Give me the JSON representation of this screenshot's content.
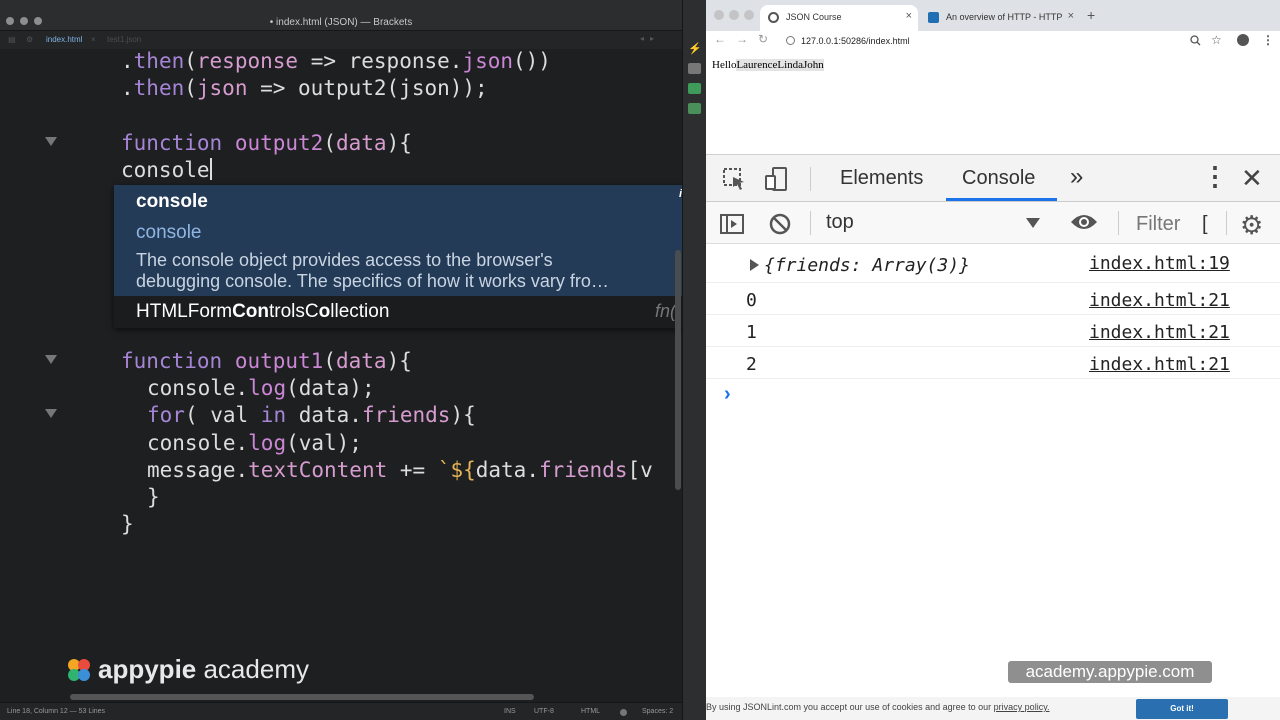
{
  "editor": {
    "window_title": "• index.html (JSON) — Brackets",
    "tabs": [
      {
        "label": "index.html"
      },
      {
        "label": "test1.json"
      }
    ],
    "code": {
      "l1": {
        "p1": ".",
        "p2": "then",
        "p3": "(",
        "p4": "response",
        "p5": " => response.",
        "p6": "json",
        "p7": "())"
      },
      "l2": {
        "p1": ".",
        "p2": "then",
        "p3": "(",
        "p4": "json",
        "p5": " => output2(json));"
      },
      "l3": {
        "p1": "function",
        "p2": " ",
        "p3": "output2",
        "p4": "(",
        "p5": "data",
        "p6": "){"
      },
      "l4": {
        "p1": "console"
      },
      "l5": {
        "p1": "function",
        "p2": " ",
        "p3": "output1",
        "p4": "(",
        "p5": "data",
        "p6": "){"
      },
      "l6": {
        "p1": "console.",
        "p2": "log",
        "p3": "(data);"
      },
      "l7": {
        "p1": "for",
        "p2": "( val ",
        "p3": "in",
        "p4": " data.",
        "p5": "friends",
        "p6": "){"
      },
      "l8": {
        "p1": "console.",
        "p2": "log",
        "p3": "(val);"
      },
      "l9": {
        "p1": "message.",
        "p2": "textContent",
        "p3": " += ",
        "p4": "`${",
        "p5": "data.",
        "p6": "friends",
        "p7": "[v"
      },
      "l10": {
        "p1": "}"
      },
      "l11": {
        "p1": "}"
      }
    },
    "hints": {
      "selected": "console",
      "alt": "console",
      "description_1": "The console object provides access to the browser's",
      "description_2": "debugging console. The specifics of how it works vary fro…",
      "info_icon": "i",
      "bottom_pre": "HTMLForm",
      "bottom_bold1": "Con",
      "bottom_mid": "trols",
      "bottom_c": "C",
      "bottom_bold2": "o",
      "bottom_ll": "ll",
      "bottom_post": "ection",
      "bottom_type": "fn()"
    },
    "watermark": {
      "brand": "appypie",
      "suffix": " academy"
    },
    "status": {
      "position": "Line 18, Column 12 — 53 Lines",
      "mode": "INS",
      "encoding": "UTF-8",
      "language": "HTML",
      "spaces": "Spaces: 2"
    }
  },
  "browser": {
    "tabs": [
      {
        "title": "JSON Course",
        "close": "×"
      },
      {
        "title": "An overview of HTTP - HTTP | M",
        "close": "×"
      }
    ],
    "new_tab": "+",
    "nav": {
      "back": "←",
      "forward": "→",
      "reload": "↻"
    },
    "url": "127.0.0.1:50286/index.html",
    "page": {
      "hello": "Hello",
      "names": "LaurenceLindaJohn"
    },
    "devtools": {
      "tabs": [
        "Elements",
        "Console"
      ],
      "more": "»",
      "kebab": "⋮",
      "close": "✕",
      "context": "top",
      "filter": "Filter",
      "filter_cursor": "[",
      "gear": "⚙",
      "messages": [
        {
          "text": "{friends: Array(3)}",
          "source": "index.html:19"
        },
        {
          "text": "0",
          "source": "index.html:21"
        },
        {
          "text": "1",
          "source": "index.html:21"
        },
        {
          "text": "2",
          "source": "index.html:21"
        }
      ],
      "prompt": "›"
    },
    "watermark": "academy.appypie.com",
    "cookie": {
      "text": "By using JSONLint.com you accept our use of cookies and agree to our ",
      "link": "privacy policy.",
      "button": "Got it!"
    }
  },
  "colors": {
    "editor_bg": "#1d1f21",
    "hint_bg": "#243b57",
    "keyword": "#a785d6",
    "accent_blue": "#1a73e8"
  }
}
